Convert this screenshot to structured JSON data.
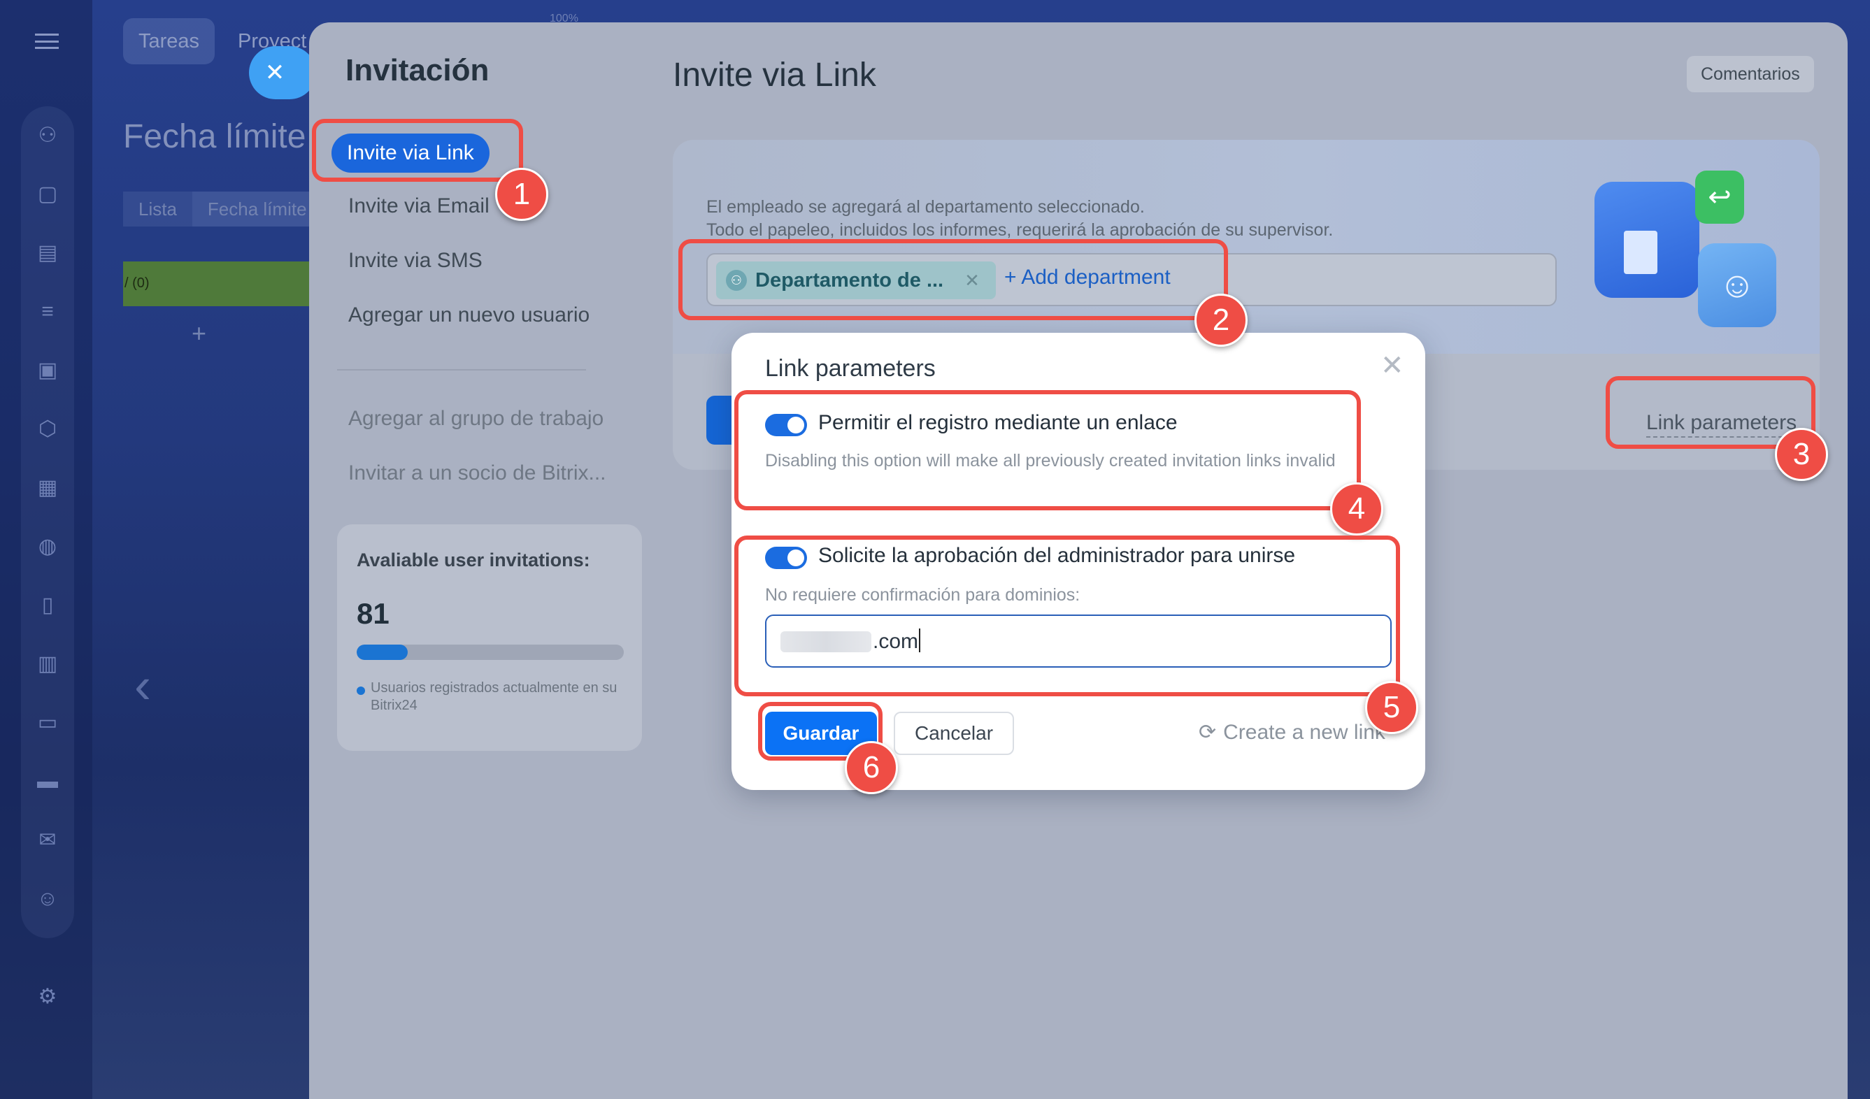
{
  "background": {
    "tabs": [
      "Tareas",
      "Proyect"
    ],
    "zoom_label": "100%",
    "page_title": "Fecha límite",
    "views": [
      "Lista",
      "Fecha límite"
    ],
    "row_label": "/ (0)",
    "add_symbol": "+"
  },
  "sidebar": {
    "title": "Invitación",
    "items": [
      {
        "label": "Invite via Link",
        "active": true
      },
      {
        "label": "Invite via Email"
      },
      {
        "label": "Invite via SMS"
      },
      {
        "label": "Agregar un nuevo usuario"
      }
    ],
    "secondary_items": [
      {
        "label": "Agregar al grupo de trabajo"
      },
      {
        "label": "Invitar a un socio de Bitrix..."
      }
    ],
    "quota": {
      "label": "Avaliable user invitations:",
      "value": "81",
      "progress_percent": 19,
      "note": "Usuarios registrados actualmente en su Bitrix24"
    }
  },
  "main": {
    "title": "Invite via Link",
    "comments_button": "Comentarios",
    "hero": {
      "line1": "El empleado se agregará al departamento seleccionado.",
      "line2": "Todo el papeleo, incluidos los informes, requerirá la aprobación de su supervisor.",
      "department_chip": "Departamento de ...",
      "add_department": "+ Add department"
    },
    "link_parameters": "Link parameters"
  },
  "modal": {
    "title": "Link parameters",
    "option1": {
      "enabled": true,
      "label": "Permitir el registro mediante un enlace",
      "hint": "Disabling this option will make all previously created invitation links invalid"
    },
    "option2": {
      "enabled": true,
      "label": "Solicite la aprobación del administrador para unirse",
      "hint": "No requiere confirmación para dominios:",
      "domain_value": ".com"
    },
    "save_button": "Guardar",
    "cancel_button": "Cancelar",
    "new_link": "Create a new link"
  },
  "annotations": [
    "1",
    "2",
    "3",
    "4",
    "5",
    "6"
  ],
  "colors": {
    "accent": "#1b6ce0",
    "highlight": "#ef4d45",
    "save_button": "#0b72f5"
  }
}
